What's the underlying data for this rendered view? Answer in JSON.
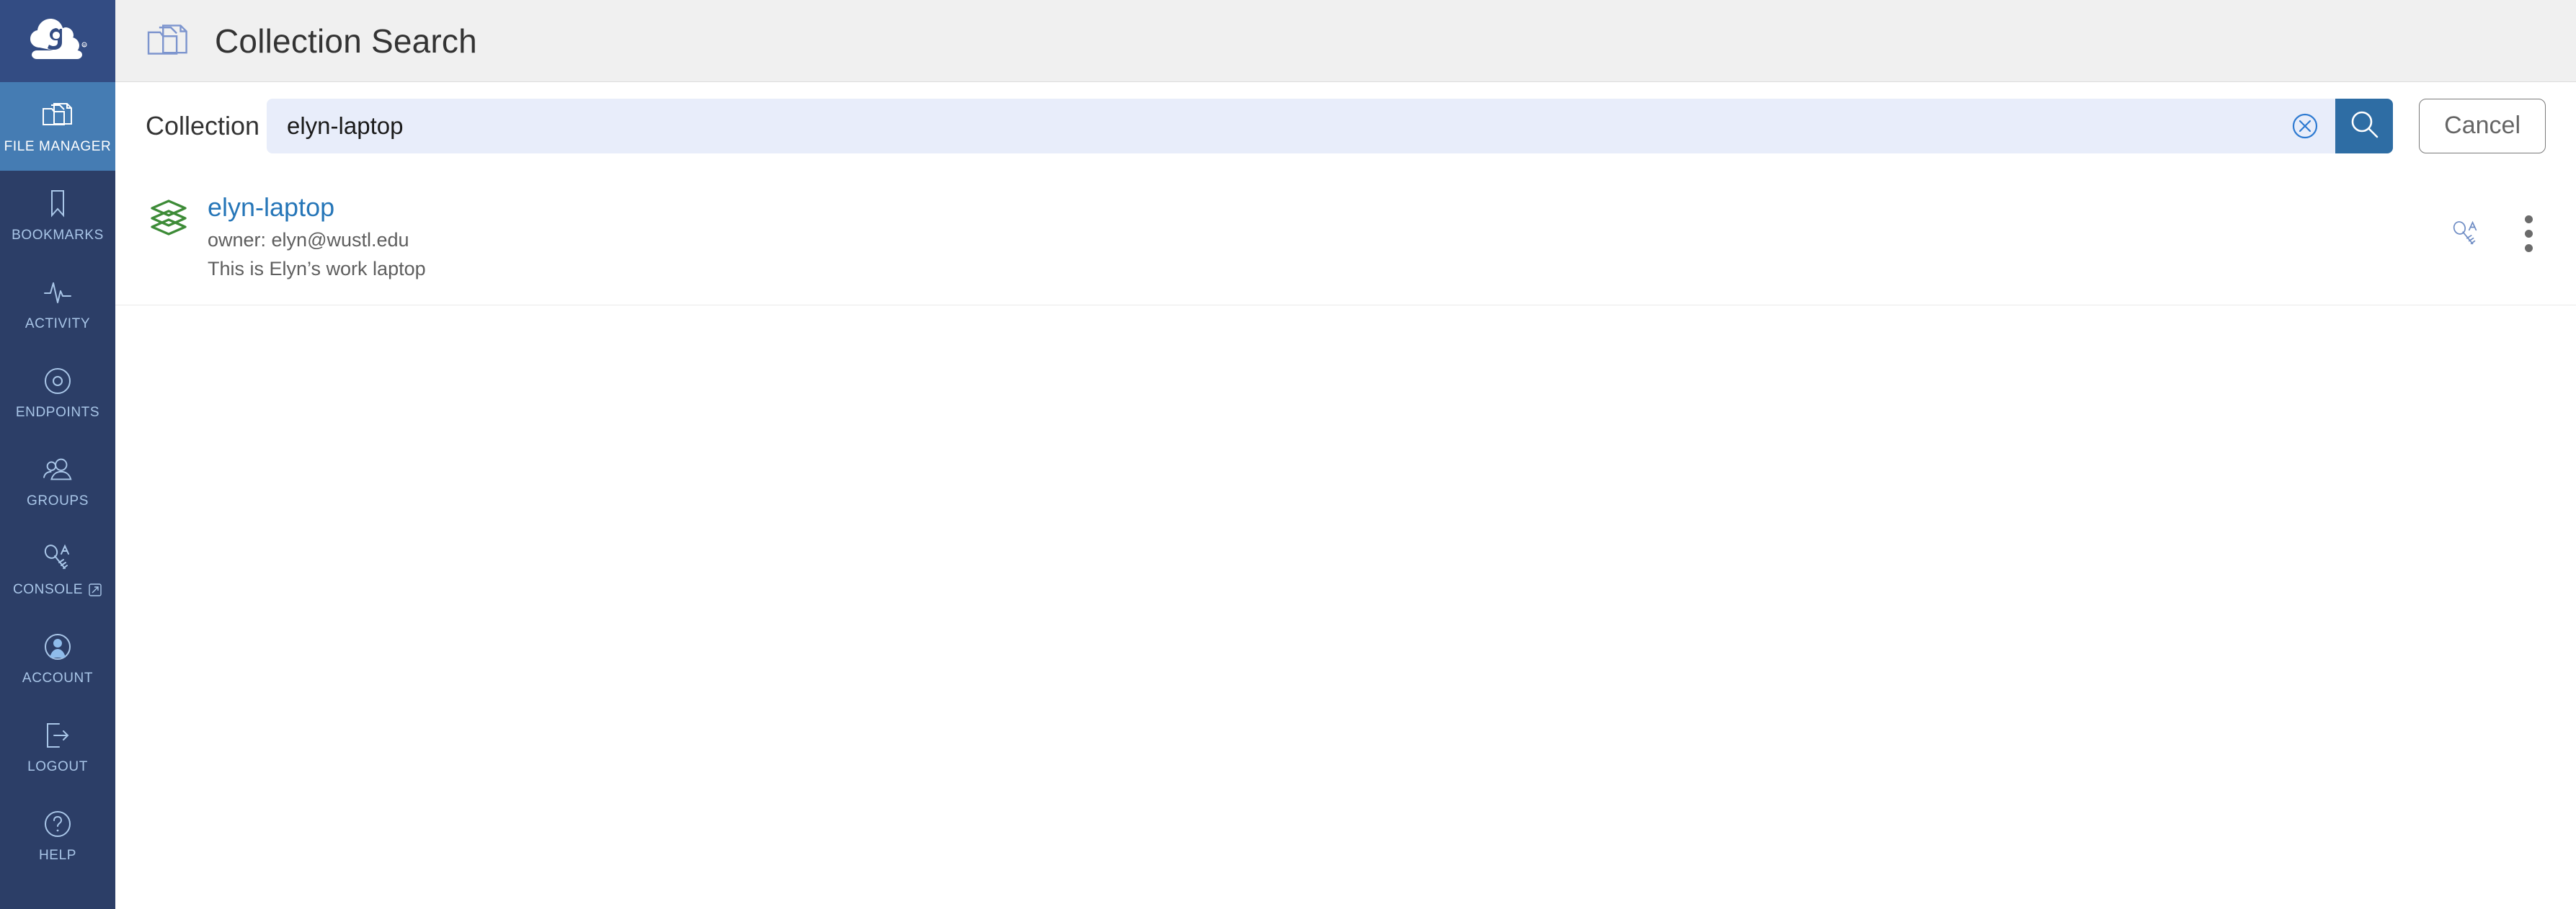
{
  "brand": {
    "logo_name": "globus-logo",
    "logo_bg": "#334C83",
    "sidebar_bg": "#2C3E67",
    "active_bg": "#457CB3"
  },
  "sidebar": {
    "items": [
      {
        "label": "FILE MANAGER",
        "icon": "folder-icon",
        "active": true,
        "external": false
      },
      {
        "label": "BOOKMARKS",
        "icon": "bookmark-icon",
        "active": false,
        "external": false
      },
      {
        "label": "ACTIVITY",
        "icon": "pulse-icon",
        "active": false,
        "external": false
      },
      {
        "label": "ENDPOINTS",
        "icon": "target-icon",
        "active": false,
        "external": false
      },
      {
        "label": "GROUPS",
        "icon": "people-icon",
        "active": false,
        "external": false
      },
      {
        "label": "CONSOLE",
        "icon": "key-a-icon",
        "active": false,
        "external": true
      },
      {
        "label": "ACCOUNT",
        "icon": "user-circle-icon",
        "active": false,
        "external": false
      },
      {
        "label": "LOGOUT",
        "icon": "logout-icon",
        "active": false,
        "external": false
      },
      {
        "label": "HELP",
        "icon": "question-circle-icon",
        "active": false,
        "external": false
      }
    ]
  },
  "header": {
    "title": "Collection Search",
    "icon": "collection-folder-icon",
    "background": "#F0F0F0"
  },
  "search": {
    "label": "Collection",
    "value": "elyn-laptop",
    "placeholder": "Search",
    "clear_icon": "circle-x-icon",
    "search_icon": "search-icon",
    "cancel_label": "Cancel",
    "input_bg": "#E8EDFA",
    "button_bg": "#2E6DA4"
  },
  "results": {
    "rows": [
      {
        "icon": "stacked-diamonds-icon",
        "icon_color": "#3D8B37",
        "title": "elyn-laptop",
        "owner": "owner: elyn@wustl.edu",
        "description": "This is Elyn’s work laptop",
        "actions": {
          "console_icon": "key-a-icon",
          "overflow_icon": "kebab-menu-icon"
        }
      }
    ]
  }
}
